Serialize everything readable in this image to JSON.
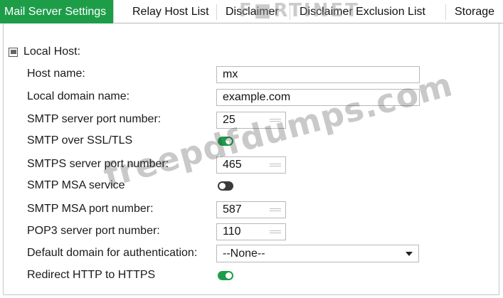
{
  "tabs": [
    {
      "label": "Mail Server Settings",
      "active": true
    },
    {
      "label": "Relay Host List",
      "active": false
    },
    {
      "label": "Disclaimer",
      "active": false
    },
    {
      "label": "Disclaimer Exclusion List",
      "active": false
    },
    {
      "label": "Storage",
      "active": false
    }
  ],
  "logo": "F■RTINET",
  "section": {
    "title": "Local Host:"
  },
  "fields": {
    "host_name": {
      "label": "Host name:",
      "value": "mx"
    },
    "local_domain": {
      "label": "Local domain name:",
      "value": "example.com"
    },
    "smtp_port": {
      "label": "SMTP server port number:",
      "value": "25"
    },
    "smtp_ssl": {
      "label": "SMTP over SSL/TLS",
      "enabled": true
    },
    "smtps_port": {
      "label": "SMTPS server port number:",
      "value": "465"
    },
    "smtp_msa": {
      "label": "SMTP MSA service",
      "enabled": false
    },
    "smtp_msa_port": {
      "label": "SMTP MSA port number:",
      "value": "587"
    },
    "pop3_port": {
      "label": "POP3 server port number:",
      "value": "110"
    },
    "default_domain": {
      "label": "Default domain for authentication:",
      "value": "--None--"
    },
    "redirect_https": {
      "label": "Redirect HTTP to HTTPS",
      "enabled": true
    }
  },
  "watermark": "freepdfdumps.com",
  "colors": {
    "accent": "#1e9d49",
    "toggle_off": "#3a3a3a"
  }
}
